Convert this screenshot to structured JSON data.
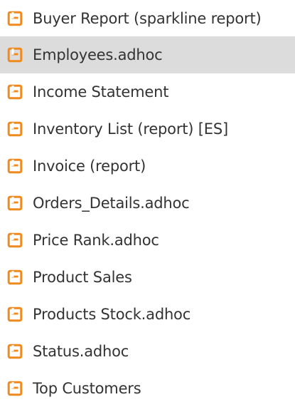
{
  "colors": {
    "icon": "#f08a1e",
    "text": "#333333",
    "selected_bg": "#dcdcdc"
  },
  "files": [
    {
      "label": "Buyer Report (sparkline report)",
      "icon": "report-file-icon",
      "selected": false
    },
    {
      "label": "Employees.adhoc",
      "icon": "report-file-icon",
      "selected": true
    },
    {
      "label": "Income Statement",
      "icon": "report-file-icon",
      "selected": false
    },
    {
      "label": "Inventory List (report) [ES]",
      "icon": "report-file-icon",
      "selected": false
    },
    {
      "label": "Invoice (report)",
      "icon": "report-file-icon",
      "selected": false
    },
    {
      "label": "Orders_Details.adhoc",
      "icon": "report-file-icon",
      "selected": false
    },
    {
      "label": "Price Rank.adhoc",
      "icon": "report-file-icon",
      "selected": false
    },
    {
      "label": "Product Sales",
      "icon": "report-file-icon",
      "selected": false
    },
    {
      "label": "Products Stock.adhoc",
      "icon": "report-file-icon",
      "selected": false
    },
    {
      "label": "Status.adhoc",
      "icon": "report-file-icon",
      "selected": false
    },
    {
      "label": "Top Customers",
      "icon": "report-file-icon",
      "selected": false
    }
  ]
}
